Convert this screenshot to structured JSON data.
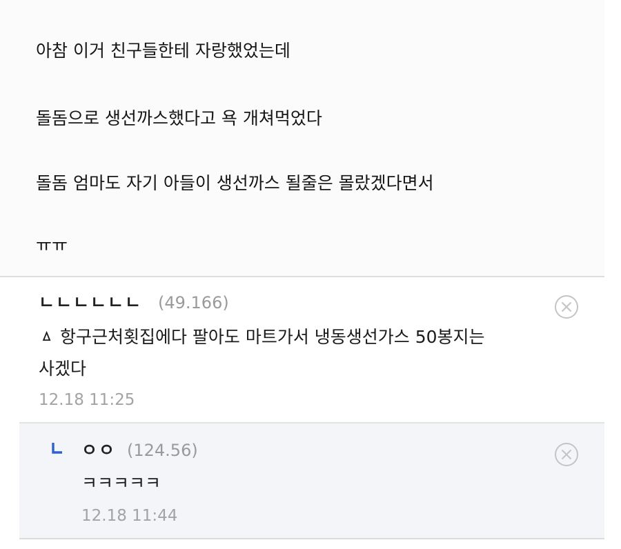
{
  "post": {
    "lines": [
      "아참 이거 친구들한테 자랑했었는데",
      "돌돔으로 생선까스했다고 욕 개쳐먹었다",
      "돌돔 엄마도 자기 아들이 생선까스 될줄은 몰랐겠다면서",
      "ㅠㅠ"
    ]
  },
  "comments": [
    {
      "author": "ㄴㄴㄴㄴㄴㄴ",
      "score": "(49.166)",
      "text_line1": "ㅿ    항구근처횟집에다 팔아도 마트가서 냉동생선가스 50봉지는",
      "text_line2": "사겠다",
      "date": "12.18 11:25",
      "icon": "close-circle-icon"
    }
  ],
  "replies": [
    {
      "author": "ㅇㅇ",
      "score": "(124.56)",
      "text": "ㅋㅋㅋㅋㅋ",
      "date": "12.18 11:44",
      "reply_icon": "reply-arrow-icon",
      "icon": "close-circle-icon"
    }
  ],
  "colors": {
    "reply_arrow": "#2f5fd0",
    "divider": "#dedede",
    "reply_bg": "#f4f5f8",
    "muted_text": "#a3a3a3"
  }
}
